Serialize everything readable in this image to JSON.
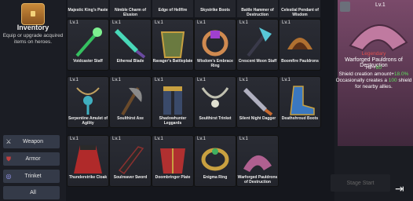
{
  "inventory": {
    "title": "Inventory",
    "description": "Equip or upgrade acquired items on heroes."
  },
  "filters": [
    {
      "label": "Weapon",
      "icon": "crossed-swords-icon"
    },
    {
      "label": "Armor",
      "icon": "armor-icon"
    },
    {
      "label": "Trinket",
      "icon": "necklace-icon"
    },
    {
      "label": "All",
      "icon": ""
    }
  ],
  "top_row": [
    "Majestic King's Paste",
    "Nimble Charm of Elusion",
    "Edge of Hellfire",
    "Skystrike Boots",
    "Battle Hammer of Destruction",
    "Celestial Pendant of Wisdom"
  ],
  "items": [
    {
      "level": "Lv.1",
      "name": "Voidcaster Staff",
      "color": "#35c060"
    },
    {
      "level": "Lv.1",
      "name": "Ethereal Blade",
      "color": "#48d8b8"
    },
    {
      "level": "Lv.1",
      "name": "Ravager's Battleplate",
      "color": "#6a7a40"
    },
    {
      "level": "Lv.1",
      "name": "Wisdom's Embrace Ring",
      "color": "#d08a50"
    },
    {
      "level": "Lv.1",
      "name": "Crescent Moon Staff",
      "color": "#58c8d8"
    },
    {
      "level": "Lv.1",
      "name": "Boomfire Pauldrons",
      "color": "#b07030"
    },
    {
      "level": "Lv.1",
      "name": "Serpentine Amulet of Agility",
      "color": "#40b0c0"
    },
    {
      "level": "Lv.1",
      "name": "Soulthirst Axe",
      "color": "#8a8a8a"
    },
    {
      "level": "Lv.1",
      "name": "Shadowhunter Leggards",
      "color": "#3a4a6a"
    },
    {
      "level": "Lv.1",
      "name": "Soulthirst Trinket",
      "color": "#c0c0b0"
    },
    {
      "level": "Lv.1",
      "name": "Silent Night Dagger",
      "color": "#b0b0c0"
    },
    {
      "level": "Lv.1",
      "name": "Deathshroud Boots",
      "color": "#3a78c0"
    },
    {
      "level": "Lv.1",
      "name": "Thunderstrike Cloak",
      "color": "#b02a2a"
    },
    {
      "level": "Lv.1",
      "name": "Soulreaver Sword",
      "color": "#2a2a2a"
    },
    {
      "level": "Lv.1",
      "name": "Doombringer Plate",
      "color": "#b03030"
    },
    {
      "level": "Lv.1",
      "name": "Enigma Ring",
      "color": "#c8a040"
    },
    {
      "level": "Lv.1",
      "name": "Warforged Pauldrons of Destruction",
      "color": "#b06090"
    }
  ],
  "detail": {
    "level": "Lv.1",
    "rarity": "Legendary",
    "name": "Warforged Pauldrons of Destruction",
    "hp_label": "HP+",
    "hp_value": "80",
    "stat1_prefix": "Shield creation amount+",
    "stat1_value": "18.0%",
    "stat2_prefix": "Occasionally creates a",
    "stat2_value": "100",
    "stat2_suffix": "shield",
    "stat3": "for nearby allies."
  },
  "stage_start": "Stage Start"
}
